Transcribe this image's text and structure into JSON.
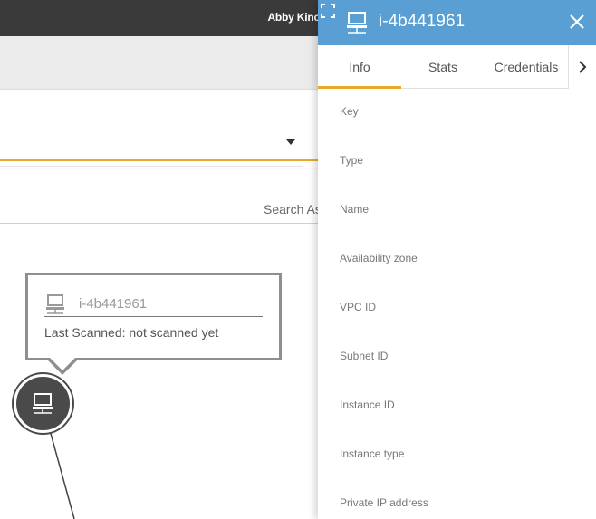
{
  "topbar": {
    "user_name": "Abby Kinc"
  },
  "search": {
    "label": "Search As"
  },
  "tooltip": {
    "title": "i-4b441961",
    "status": "Last Scanned: not scanned yet",
    "icon": "computer-icon"
  },
  "node": {
    "icon": "computer-icon"
  },
  "panel": {
    "title": "i-4b441961",
    "header_icon": "computer-icon",
    "accent_color": "#5a9fd4",
    "tab_accent_color": "#e8a92c",
    "tabs": [
      {
        "label": "Info",
        "active": true
      },
      {
        "label": "Stats",
        "active": false
      },
      {
        "label": "Credentials",
        "active": false
      }
    ],
    "fields": [
      {
        "label": "Key"
      },
      {
        "label": "Type"
      },
      {
        "label": "Name"
      },
      {
        "label": "Availability zone"
      },
      {
        "label": "VPC ID"
      },
      {
        "label": "Subnet ID"
      },
      {
        "label": "Instance ID"
      },
      {
        "label": "Instance type"
      },
      {
        "label": "Private IP address"
      }
    ]
  }
}
